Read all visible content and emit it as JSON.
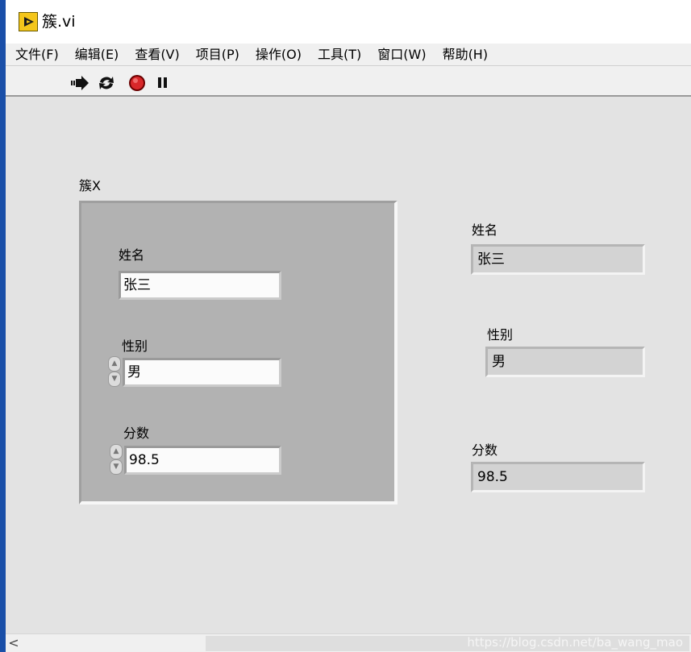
{
  "window": {
    "title": "簇.vi"
  },
  "menu": [
    "文件(F)",
    "编辑(E)",
    "查看(V)",
    "项目(P)",
    "操作(O)",
    "工具(T)",
    "窗口(W)",
    "帮助(H)"
  ],
  "toolbar": {
    "icons": [
      "run-arrow-icon",
      "run-continuously-icon",
      "abort-stop-icon",
      "pause-icon"
    ]
  },
  "cluster": {
    "label": "簇X",
    "name_label": "姓名",
    "name_value": "张三",
    "gender_label": "性别",
    "gender_value": "男",
    "score_label": "分数",
    "score_value": "98.5"
  },
  "indicators": {
    "name_label": "姓名",
    "name_value": "张三",
    "gender_label": "性别",
    "gender_value": "男",
    "score_label": "分数",
    "score_value": "98.5"
  },
  "scrollbar": {
    "left_arrow": "<"
  },
  "watermark": "https://blog.csdn.net/ba_wang_mao",
  "colors": {
    "panel_bg": "#e3e3e3",
    "cluster_bg": "#b2b2b2",
    "stop_red": "#d8282a",
    "vi_icon": "#f4c61b"
  }
}
